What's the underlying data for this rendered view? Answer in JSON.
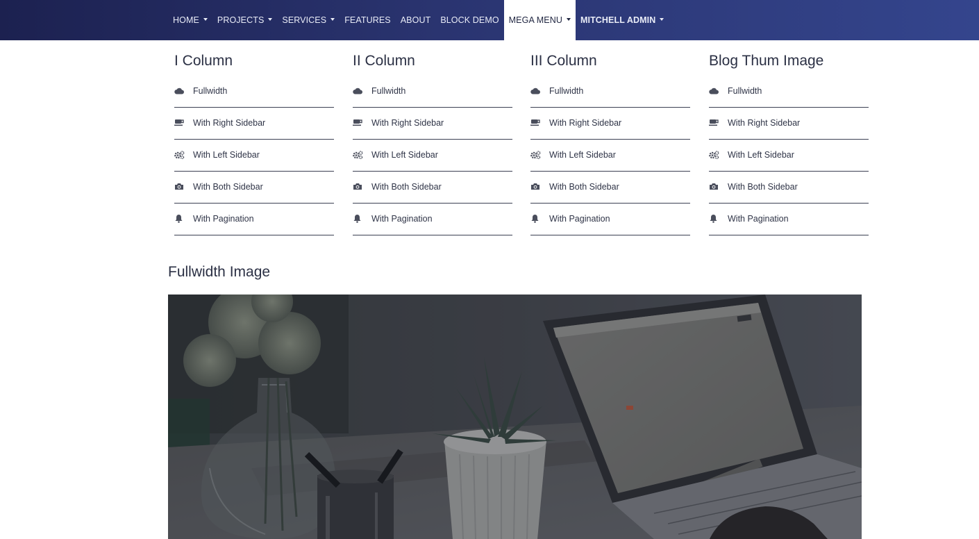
{
  "navbar": {
    "items": [
      {
        "label": "HOME",
        "dropdown": true
      },
      {
        "label": "PROJECTS",
        "dropdown": true
      },
      {
        "label": "SERVICES",
        "dropdown": true
      },
      {
        "label": "FEATURES",
        "dropdown": false
      },
      {
        "label": "ABOUT",
        "dropdown": false
      },
      {
        "label": "BLOCK DEMO",
        "dropdown": false
      },
      {
        "label": "MEGA MENU",
        "dropdown": true,
        "active": true
      },
      {
        "label": "MITCHELL ADMIN",
        "dropdown": true
      }
    ],
    "colors": {
      "gradient_start": "#1c2150",
      "gradient_end": "#34458d"
    }
  },
  "mega_menu": {
    "columns": [
      {
        "title": "I Column",
        "links": [
          {
            "icon": "cloud-icon",
            "label": "Fullwidth"
          },
          {
            "icon": "coffee-icon",
            "label": "With Right Sidebar"
          },
          {
            "icon": "cogs-icon",
            "label": "With Left Sidebar"
          },
          {
            "icon": "camera-icon",
            "label": "With Both Sidebar"
          },
          {
            "icon": "bell-icon",
            "label": "With Pagination"
          }
        ]
      },
      {
        "title": "II Column",
        "links": [
          {
            "icon": "cloud-icon",
            "label": "Fullwidth"
          },
          {
            "icon": "coffee-icon",
            "label": "With Right Sidebar"
          },
          {
            "icon": "cogs-icon",
            "label": "With Left Sidebar"
          },
          {
            "icon": "camera-icon",
            "label": "With Both Sidebar"
          },
          {
            "icon": "bell-icon",
            "label": "With Pagination"
          }
        ]
      },
      {
        "title": "III Column",
        "links": [
          {
            "icon": "cloud-icon",
            "label": "Fullwidth"
          },
          {
            "icon": "coffee-icon",
            "label": "With Right Sidebar"
          },
          {
            "icon": "cogs-icon",
            "label": "With Left Sidebar"
          },
          {
            "icon": "camera-icon",
            "label": "With Both Sidebar"
          },
          {
            "icon": "bell-icon",
            "label": "With Pagination"
          }
        ]
      },
      {
        "title": "Blog Thum Image",
        "links": [
          {
            "icon": "cloud-icon",
            "label": "Fullwidth"
          },
          {
            "icon": "coffee-icon",
            "label": "With Right Sidebar"
          },
          {
            "icon": "cogs-icon",
            "label": "With Left Sidebar"
          },
          {
            "icon": "camera-icon",
            "label": "With Both Sidebar"
          },
          {
            "icon": "bell-icon",
            "label": "With Pagination"
          }
        ]
      }
    ]
  },
  "fullwidth_section": {
    "title": "Fullwidth Image"
  }
}
